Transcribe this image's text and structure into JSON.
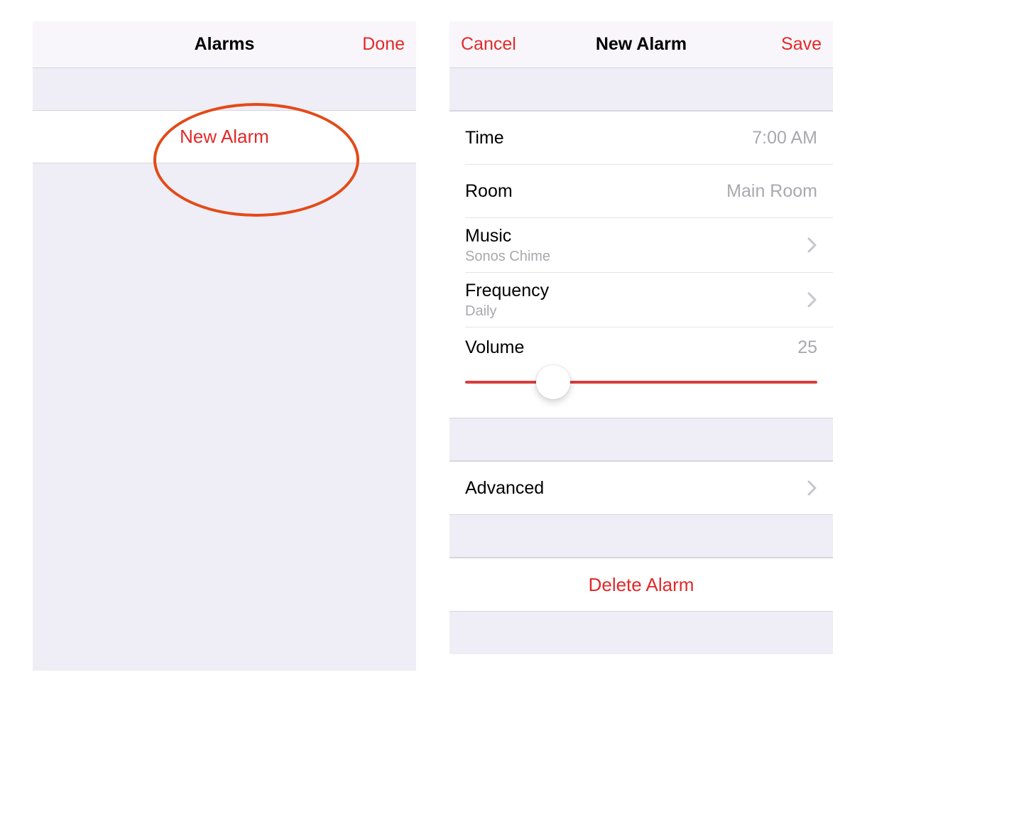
{
  "colors": {
    "accent": "#e22929",
    "callout": "#e34a17",
    "slider": "#d93d3d",
    "secondary_text": "#a9a8ae"
  },
  "left_pane": {
    "title": "Alarms",
    "done": "Done",
    "new_alarm": "New Alarm"
  },
  "right_pane": {
    "cancel": "Cancel",
    "title": "New Alarm",
    "save": "Save",
    "rows": {
      "time": {
        "label": "Time",
        "value": "7:00 AM"
      },
      "room": {
        "label": "Room",
        "value": "Main Room"
      },
      "music": {
        "label": "Music",
        "sub": "Sonos Chime"
      },
      "frequency": {
        "label": "Frequency",
        "sub": "Daily"
      },
      "volume": {
        "label": "Volume",
        "value": "25",
        "percent": 25
      },
      "advanced": {
        "label": "Advanced"
      }
    },
    "delete": "Delete Alarm"
  }
}
